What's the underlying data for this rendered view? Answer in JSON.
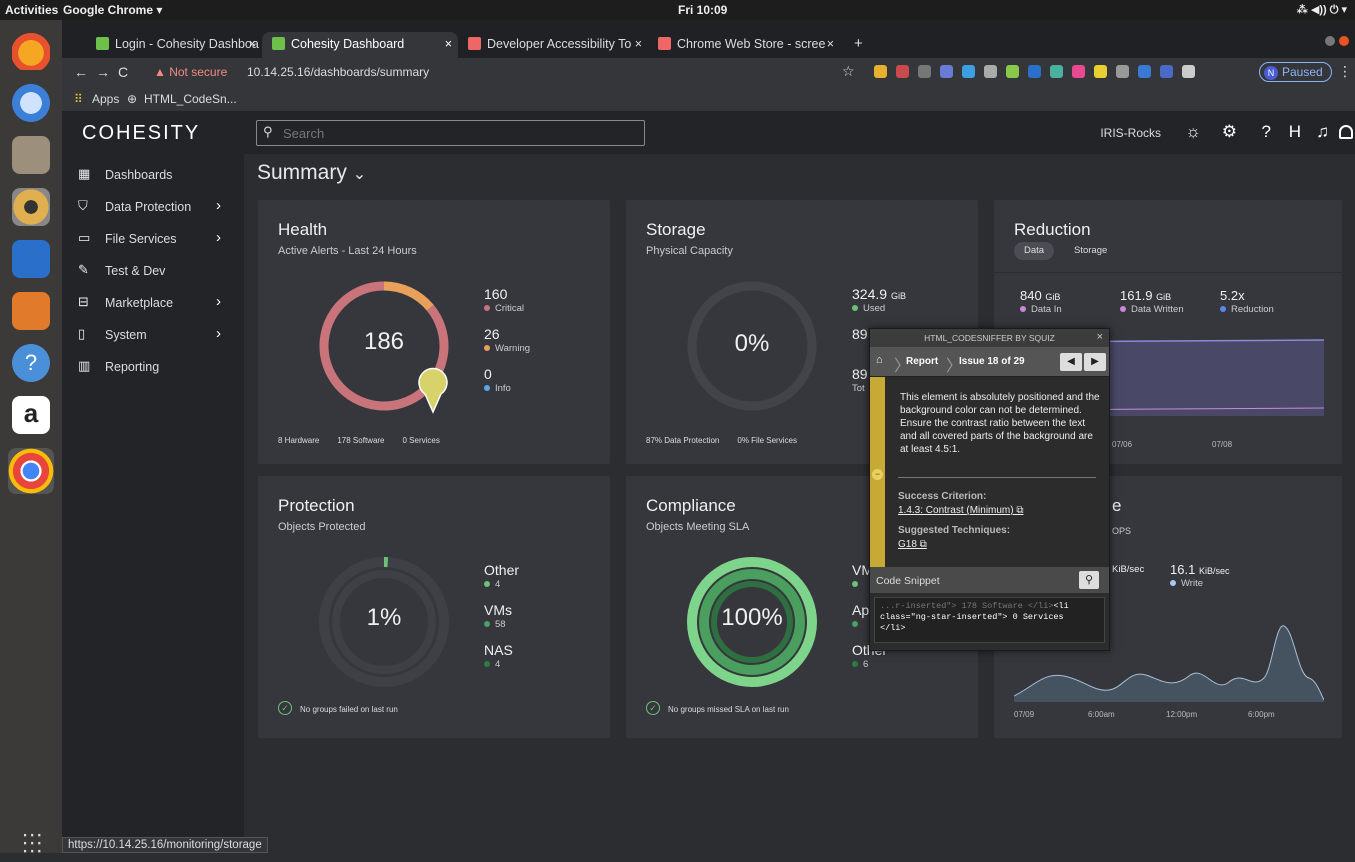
{
  "os": {
    "activities": "Activities",
    "app_name": "Google Chrome ▾",
    "clock": "Fri 10:09",
    "tray": "⁂ ◀)) ⏻ ▾"
  },
  "browser": {
    "tabs": [
      {
        "title": "Login - Cohesity Dashboa",
        "icon_color": "#6dc04a"
      },
      {
        "title": "Cohesity Dashboard",
        "icon_color": "#6dc04a"
      },
      {
        "title": "Developer Accessibility To",
        "icon_color": "#e66"
      },
      {
        "title": "Chrome Web Store - scree",
        "icon_color": "#e66"
      }
    ],
    "new_tab": "+",
    "tab_close": "×",
    "not_secure": "▲ Not secure",
    "url": "10.14.25.16/dashboards/summary",
    "paused": "Paused",
    "avatar_letter": "N",
    "bookmarks": [
      "Apps",
      "HTML_CodeSn..."
    ],
    "status_url": "https://10.14.25.16/monitoring/storage"
  },
  "app": {
    "logo": "COHESITY",
    "search_placeholder": "Search",
    "cluster": "IRIS-Rocks",
    "page_title": "Summary",
    "nav": [
      {
        "label": "Dashboards",
        "icon": "dashboards-icon",
        "chevron": false
      },
      {
        "label": "Data Protection",
        "icon": "shield-icon",
        "chevron": true
      },
      {
        "label": "File Services",
        "icon": "folder-icon",
        "chevron": true
      },
      {
        "label": "Test & Dev",
        "icon": "wrench-icon",
        "chevron": false
      },
      {
        "label": "Marketplace",
        "icon": "marketplace-icon",
        "chevron": true
      },
      {
        "label": "System",
        "icon": "system-icon",
        "chevron": true
      },
      {
        "label": "Reporting",
        "icon": "reporting-icon",
        "chevron": false
      }
    ]
  },
  "health": {
    "title": "Health",
    "subtitle": "Active Alerts - Last 24 Hours",
    "total": "186",
    "legend": [
      {
        "value": "160",
        "label": "Critical",
        "color": "#c9737a"
      },
      {
        "value": "26",
        "label": "Warning",
        "color": "#e8a05a"
      },
      {
        "value": "0",
        "label": "Info",
        "color": "#5aa8e8"
      }
    ],
    "footer": [
      "8 Hardware",
      "178 Software",
      "0 Services"
    ],
    "critical_fraction": 0.86
  },
  "storage": {
    "title": "Storage",
    "subtitle": "Physical Capacity",
    "percent": "0%",
    "used_value": "324.9",
    "used_unit": "GiB",
    "used_label": "Used",
    "row2": "89",
    "row3": "89",
    "row3_label": "Tot",
    "footer": [
      "87% Data Protection",
      "0% File Services"
    ]
  },
  "reduction": {
    "title": "Reduction",
    "pills": [
      "Data",
      "Storage"
    ],
    "stats": [
      {
        "value": "840",
        "unit": "GiB",
        "label": "Data In",
        "color": "#c98bd6"
      },
      {
        "value": "161.9",
        "unit": "GiB",
        "label": "Data Written",
        "color": "#c98bd6"
      },
      {
        "value": "5.2x",
        "unit": "",
        "label": "Reduction",
        "color": "#5a8ae8"
      }
    ],
    "x_labels": [
      "07/06",
      "07/08"
    ]
  },
  "protection": {
    "title": "Protection",
    "subtitle": "Objects Protected",
    "percent": "1%",
    "legend": [
      {
        "value": "Other",
        "sub": "4"
      },
      {
        "value": "VMs",
        "sub": "58"
      },
      {
        "value": "NAS",
        "sub": "4"
      }
    ],
    "footer": "No groups failed on last run",
    "fraction": 0.01
  },
  "compliance": {
    "title": "Compliance",
    "subtitle": "Objects Meeting SLA",
    "percent": "100%",
    "legend": [
      {
        "value": "VM",
        "sub": ""
      },
      {
        "value": "Ap",
        "sub": ""
      },
      {
        "value": "Other",
        "sub": "6"
      }
    ],
    "footer": "No groups missed SLA on last run"
  },
  "performance": {
    "title_fragment": "e",
    "subtitle_fragment": "OPS",
    "read_unit": "KiB/sec",
    "write_value": "16.1",
    "write_unit": "KiB/sec",
    "write_label": "Write",
    "x_labels": [
      "07/09",
      "6:00am",
      "12:00pm",
      "6:00pm"
    ]
  },
  "sniffer": {
    "header": "HTML_CODESNIFFER BY SQUIZ",
    "close": "×",
    "report": "Report",
    "issue": "Issue 18 of 29",
    "message": "This element is absolutely positioned and the background color can not be determined. Ensure the contrast ratio between the text and all covered parts of the background are at least 4.5:1.",
    "success_criterion_label": "Success Criterion:",
    "success_criterion": "1.4.3: Contrast (Minimum) ⧉",
    "techniques_label": "Suggested Techniques:",
    "technique": "G18 ⧉",
    "code_snippet_label": "Code Snippet",
    "code_line1_dim": "...r-inserted\"> 178 Software </li>",
    "code_line1": "<li",
    "code_line2": "class=\"ng-star-inserted\"> 0 Services",
    "code_line3": "</li>"
  }
}
